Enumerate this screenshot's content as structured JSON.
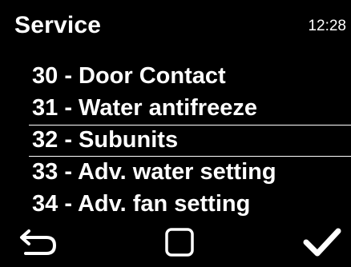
{
  "header": {
    "title": "Service",
    "time": "12:28"
  },
  "menu": {
    "items": [
      {
        "label": "30 - Door Contact"
      },
      {
        "label": "31 - Water antifreeze"
      },
      {
        "label": "32 - Subunits"
      },
      {
        "label": "33 - Adv. water setting"
      },
      {
        "label": "34 - Adv. fan setting"
      }
    ],
    "selected_index": 2
  },
  "softkeys": {
    "left_icon": "back-arrow-icon",
    "center_icon": "home-square-icon",
    "right_icon": "checkmark-icon"
  },
  "colors": {
    "background": "#000000",
    "foreground": "#ffffff"
  }
}
